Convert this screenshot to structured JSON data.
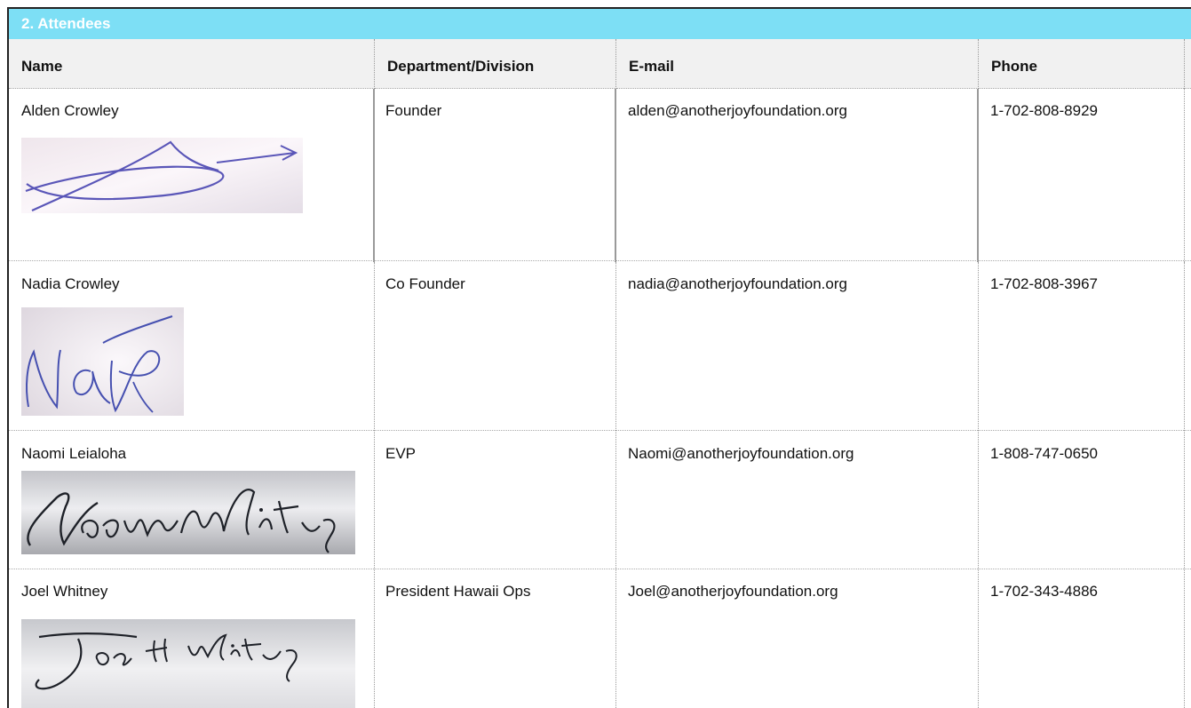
{
  "section": {
    "title": "2. Attendees"
  },
  "columns": [
    "Name",
    "Department/Division",
    "E-mail",
    "Phone"
  ],
  "rows": [
    {
      "name": "Alden Crowley",
      "department": "Founder",
      "email": "alden@anotherjoyfoundation.org",
      "phone": "1-702-808-8929",
      "signature_icon": "signature-alden-image"
    },
    {
      "name": "Nadia Crowley",
      "department": "Co Founder",
      "email": "nadia@anotherjoyfoundation.org",
      "phone": "1-702-808-3967",
      "signature_icon": "signature-nadia-image"
    },
    {
      "name": "Naomi Leialoha",
      "department": "EVP",
      "email": "Naomi@anotherjoyfoundation.org",
      "phone": "1-808-747-0650",
      "signature_icon": "signature-naomi-image"
    },
    {
      "name": "Joel Whitney",
      "department": "President Hawaii Ops",
      "email": "Joel@anotherjoyfoundation.org",
      "phone": "1-702-343-4886",
      "signature_icon": "signature-joel-image"
    }
  ],
  "colors": {
    "header_bg": "#7ddff5",
    "header_text": "#ffffff",
    "column_header_bg": "#f1f1f1",
    "ink_blue": "#3d43a8",
    "ink_dark": "#1e2128"
  }
}
